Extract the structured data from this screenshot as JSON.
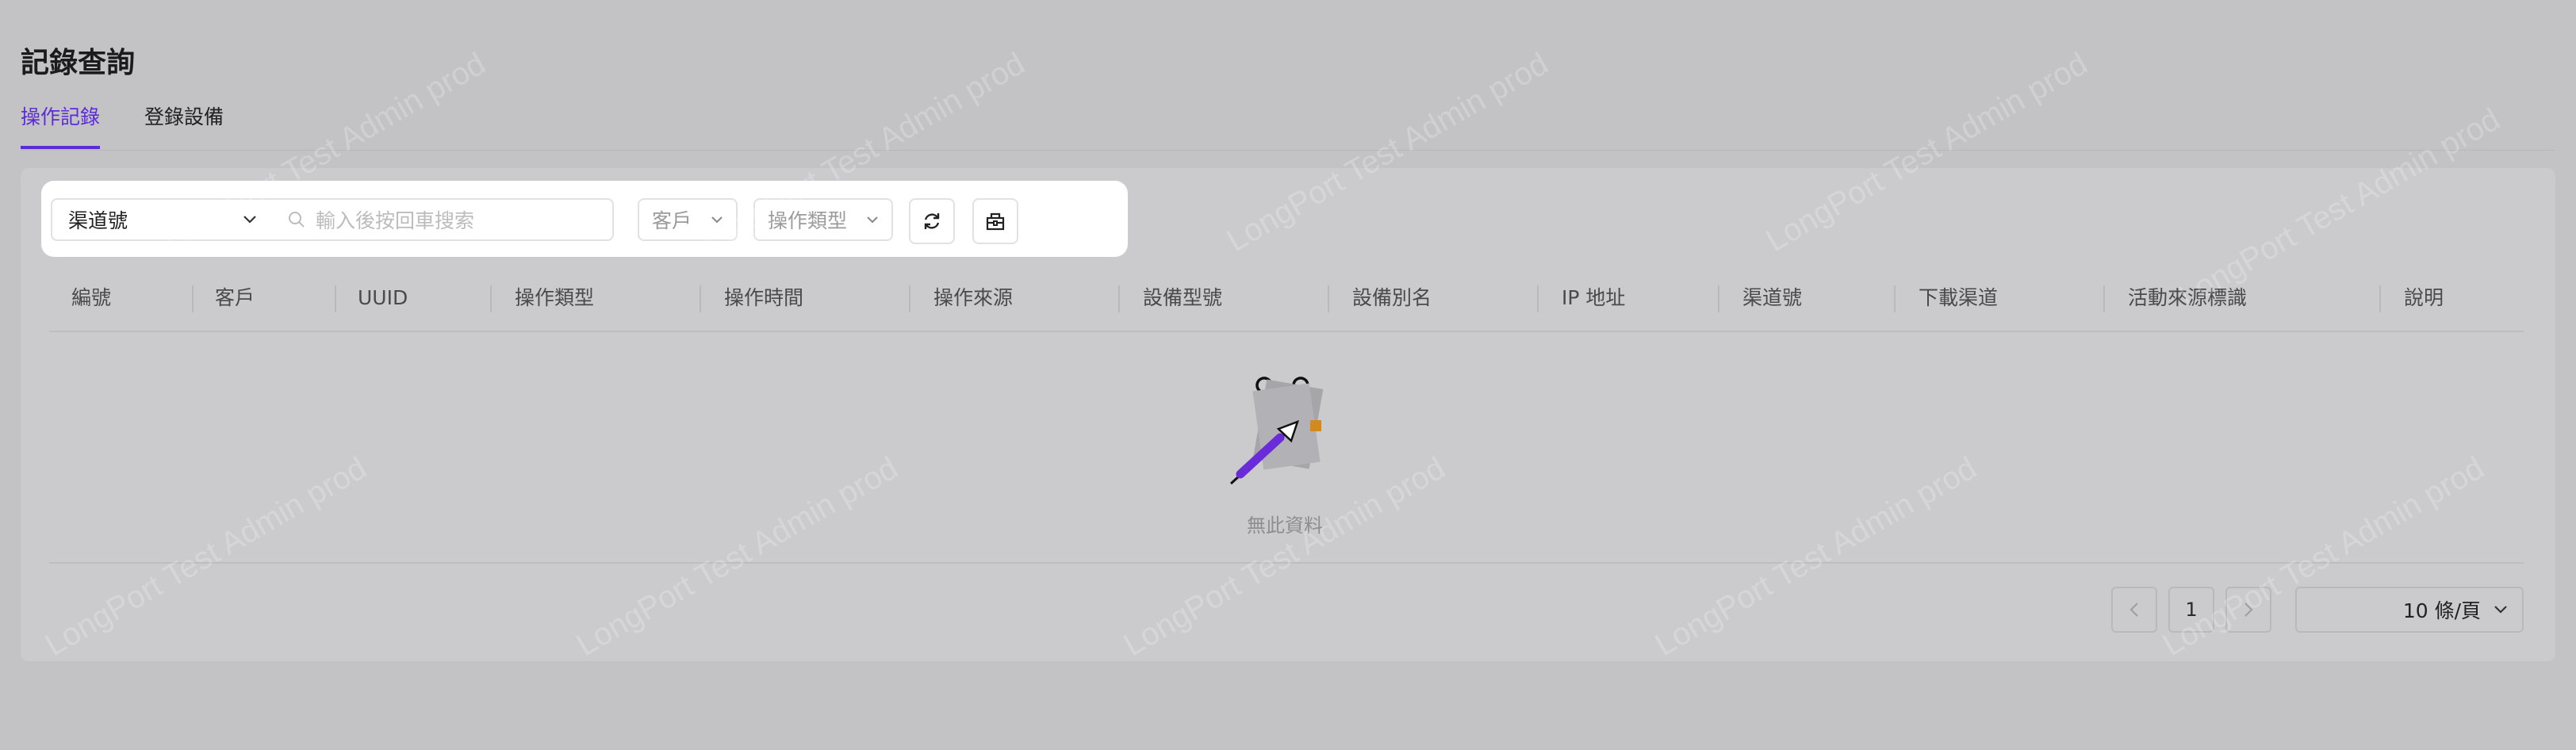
{
  "page": {
    "title": "記錄查詢"
  },
  "tabs": [
    {
      "label": "操作記錄",
      "active": true
    },
    {
      "label": "登錄設備",
      "active": false
    }
  ],
  "toolbar": {
    "channel_select": "渠道號",
    "search_placeholder": "輸入後按回車搜索",
    "customer_filter": "客戶",
    "type_filter": "操作類型",
    "refresh_icon": "refresh-icon",
    "export_icon": "export-icon"
  },
  "table": {
    "columns": [
      "編號",
      "客戶",
      "UUID",
      "操作類型",
      "操作時間",
      "操作來源",
      "設備型號",
      "設備別名",
      "IP 地址",
      "渠道號",
      "下載渠道",
      "活動來源標識",
      "說明"
    ],
    "empty_text": "無此資料"
  },
  "pagination": {
    "current_page": "1",
    "page_size": "10 條/頁"
  },
  "watermark": "LongPort Test Admin prod",
  "colors": {
    "accent": "#5b2bd6",
    "background": "#c3c3c6",
    "panel": "#cbcbce"
  }
}
